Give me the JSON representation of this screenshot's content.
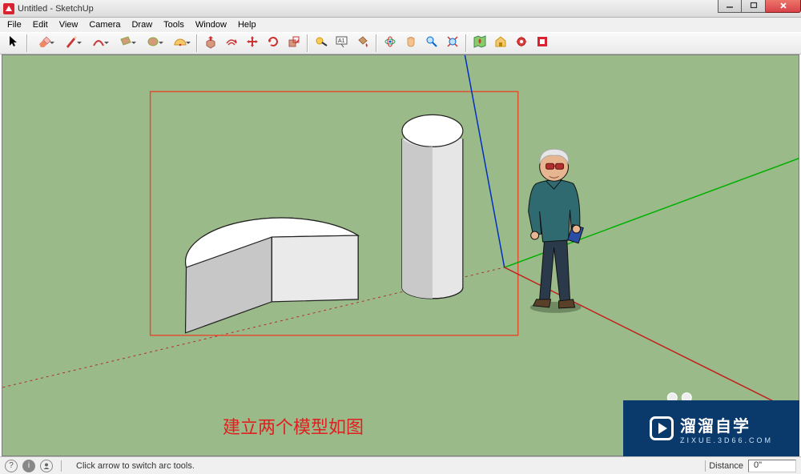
{
  "titlebar": {
    "title": "Untitled - SketchUp"
  },
  "menu": {
    "items": [
      "File",
      "Edit",
      "View",
      "Camera",
      "Draw",
      "Tools",
      "Window",
      "Help"
    ]
  },
  "toolbar": {
    "tools": [
      {
        "name": "select-tool",
        "icon": "cursor"
      },
      {
        "name": "eraser-tool",
        "icon": "eraser",
        "dd": true
      },
      {
        "name": "line-tool",
        "icon": "pencil",
        "dd": true
      },
      {
        "name": "freehand-tool",
        "icon": "arc",
        "dd": true
      },
      {
        "name": "rectangle-tool",
        "icon": "rect",
        "dd": true
      },
      {
        "name": "circle-tool",
        "icon": "circle",
        "dd": true
      },
      {
        "name": "polygon-tool",
        "icon": "poly",
        "dd": true
      },
      {
        "sep": true
      },
      {
        "name": "pushpull-tool",
        "icon": "pushpull"
      },
      {
        "name": "offset-tool",
        "icon": "offset"
      },
      {
        "name": "move-tool",
        "icon": "move"
      },
      {
        "name": "rotate-tool",
        "icon": "rotate"
      },
      {
        "name": "scale-tool",
        "icon": "scale"
      },
      {
        "sep": true
      },
      {
        "name": "tape-tool",
        "icon": "tape"
      },
      {
        "name": "text-tool",
        "icon": "text"
      },
      {
        "name": "paint-tool",
        "icon": "paint"
      },
      {
        "sep": true
      },
      {
        "name": "orbit-tool",
        "icon": "orbit"
      },
      {
        "name": "pan-tool",
        "icon": "pan"
      },
      {
        "name": "zoom-tool",
        "icon": "zoom"
      },
      {
        "name": "zoomext-tool",
        "icon": "zoomext"
      },
      {
        "sep": true
      },
      {
        "name": "location-tool",
        "icon": "map"
      },
      {
        "name": "warehouse-tool",
        "icon": "whouse"
      },
      {
        "name": "extensions-tool",
        "icon": "ext"
      },
      {
        "name": "layout-tool",
        "icon": "layout"
      }
    ]
  },
  "annotation": {
    "text": "建立两个模型如图"
  },
  "statusbar": {
    "hint": "Click arrow to switch arc tools.",
    "distance_label": "Distance",
    "distance_value": "0\""
  },
  "watermark": {
    "brand": "溜溜自学",
    "url": "ZIXUE.3D66.COM"
  }
}
